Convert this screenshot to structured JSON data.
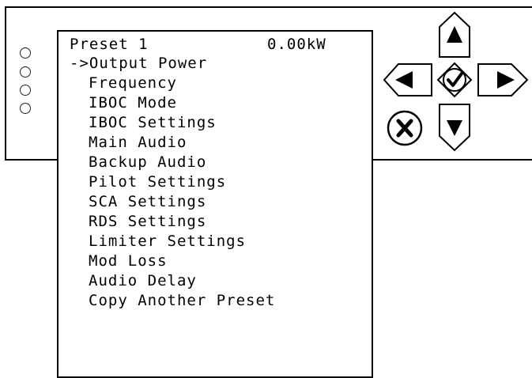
{
  "lcd": {
    "preset_label": "Preset 1",
    "power_reading": "0.00kW",
    "selection_marker": "->",
    "menu_items": [
      "Output Power",
      "Frequency",
      "IBOC Mode",
      "IBOC Settings",
      "Main Audio",
      "Backup Audio",
      "Pilot Settings",
      "SCA Settings",
      "RDS Settings",
      "Limiter Settings",
      "Mod Loss",
      "Audio Delay",
      "Copy Another Preset"
    ]
  },
  "keypad": {
    "up_icon": "triangle-up-icon",
    "down_icon": "triangle-down-icon",
    "left_icon": "triangle-left-icon",
    "right_icon": "triangle-right-icon",
    "enter_icon": "check-icon",
    "cancel_icon": "x-icon"
  }
}
